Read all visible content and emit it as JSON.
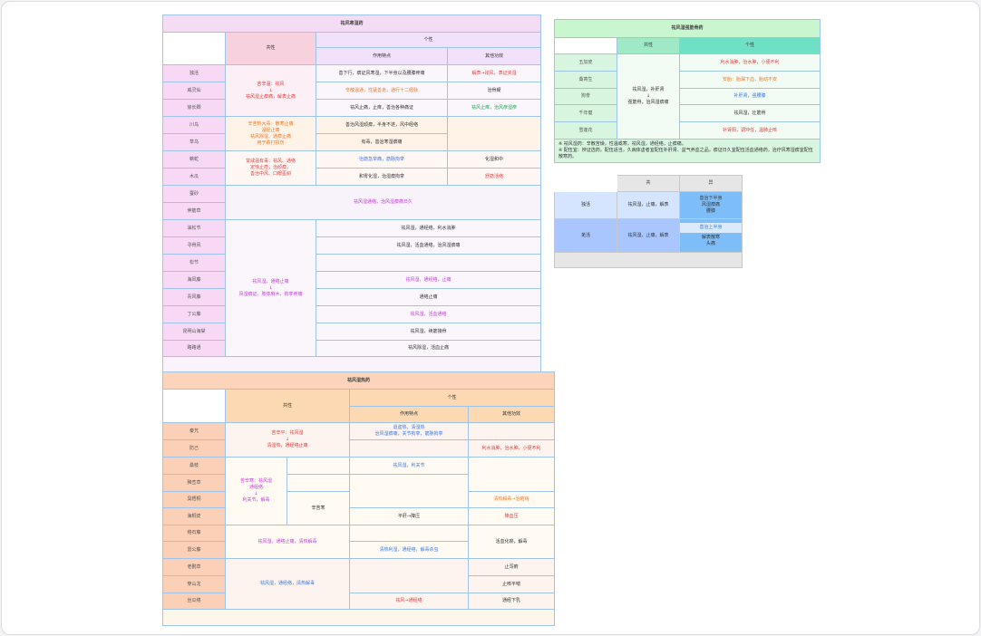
{
  "t1": {
    "title": "祛风寒湿药",
    "h_main": "共性",
    "h_ind": "个性",
    "h_effect": "作用特点",
    "h_other": "其他功效",
    "rows": [
      "独活",
      "威灵仙",
      "徐长卿",
      "川乌",
      "草乌",
      "蕲蛇",
      "木瓜",
      "蚕砂",
      "伸筋草",
      "油松节",
      "寻骨风",
      "松节",
      "海风藤",
      "青风藤",
      "丁公藤",
      "昆明山海棠",
      "路路通"
    ],
    "c_dh": "苦辛温：祛风<br>↓<br>祛风湿止痹痛，解表止痛",
    "c_cw": "辛苦热大毒：散寒止痛<br>温经止痛<br>祛风除湿、通痹止痛<br>用于跌打损伤",
    "c_qs": "甘咸温有毒：祛风、通络<br>定惊止痉，治顽痹，<br>善治中风、口眼歪斜",
    "c_gen": "祛风湿，通络止痛<br>↓<br>风湿痹证、肢体麻木、拘挛疼痛",
    "e1": "善下行，痹证风寒湿，下半身以及腰膝疼痛",
    "o1": "解表→祛风，表证夹湿",
    "e2": "辛散温通，性猛善走，通行十二经脉",
    "o2": "治骨鲠",
    "e3": "祛风止痛，止痒，善治各种痛证",
    "o3": "祛风止痒，治风疹湿疹",
    "e4": "善治风湿顽痹，半身不遂，风中经络",
    "e5": "有毒，善治寒湿痹痛",
    "e6": "治筋急挛痛，筋脉拘挛",
    "o6": "化湿和中",
    "e7": "和胃化湿，治湿痹拘挛",
    "o7": "舒筋活络",
    "e8": "祛风湿通络，治风湿痹痛日久",
    "e9": "祛风湿，通经络，利水消肿",
    "e10": "祛风湿，活血通络，治风湿痹痛",
    "e11": "",
    "e12": "祛风湿，通经络，止痛",
    "e13": "通络止痛",
    "e14": "祛风湿，活血通络",
    "e15": "祛风湿，续筋接骨",
    "e16": "祛风除湿，活血止痛"
  },
  "t2": {
    "title": "祛风湿热药",
    "h_main": "共性",
    "h_ind": "个性",
    "h_effect": "作用特点",
    "h_other": "其他功效",
    "rows": [
      "秦艽",
      "防己",
      "桑枝",
      "豨莶草",
      "臭梧桐",
      "海桐皮",
      "络石藤",
      "雷公藤",
      "老鹳草",
      "穿山龙",
      "丝瓜络"
    ],
    "g1": "苦辛平：祛风湿<br>↓<br>清湿热，通经络止痛",
    "g2": "苦辛寒：祛风湿<br>通经络<br>↓<br>利关节，解毒",
    "g3": "辛苦寒",
    "g4": "祛风湿，通络止痛，清热解毒",
    "g5": "祛风湿，通经络，清热解毒",
    "a1": "退虚热，清湿热<br>治风湿痹痛，关节拘挛，筋脉拘挛",
    "a2": "",
    "o2": "利水消肿，治水肿，小便不利",
    "a3": "祛风湿，利关节",
    "o4": "清热解毒→治疮疡",
    "o5": "降血压",
    "a5": "平肝→降压",
    "a6": "",
    "a7": "祛风通络，凉血消肿",
    "o8": "活血化瘀，解毒",
    "a8": "清热利湿，通经络，解毒杀虫",
    "o9": "止泻痢",
    "o10": "止咳平喘",
    "a11": "祛风→通经络",
    "o11": "通经下乳"
  },
  "t3": {
    "title": "祛风湿强筋骨药",
    "h_main": "共性",
    "h_ind": "个性",
    "rows": [
      "五加皮",
      "桑寄生",
      "狗脊",
      "千年健",
      "雪莲花"
    ],
    "gen": "祛风湿，补肝肾<br>↓<br>强筋骨，治风湿痹痛",
    "i1": "利水消肿，治水肿，小便不利",
    "i2": "安胎：胎漏下血，胎动不安",
    "i3": "补肝肾，强腰膝",
    "i4": "祛风湿，壮筋骨",
    "i5": "补肾阳，调冲任，温肺止咳",
    "note": "※ 祛风湿药：辛散苦燥，性温或寒，祛风湿，通经络，止痹痛。<br>※ 配伍宜：辨证选药，配伍适当，久病体虚者宜配伍补肝肾、益气养血之品，痹证日久宜配伍活血通络药，治疗风寒湿痹宜配伍散寒药。"
  },
  "t4": {
    "h1": "共",
    "h2": "异",
    "r1": "独活",
    "r2": "羌活",
    "c1": "祛风湿，止痛，解表",
    "c2": "祛风湿，止痛，解表",
    "d1": "善治下半身<br>风湿痹痛<br>腰膝",
    "d2": "善治上半身",
    "d3": "解表散寒<br>头痛"
  }
}
